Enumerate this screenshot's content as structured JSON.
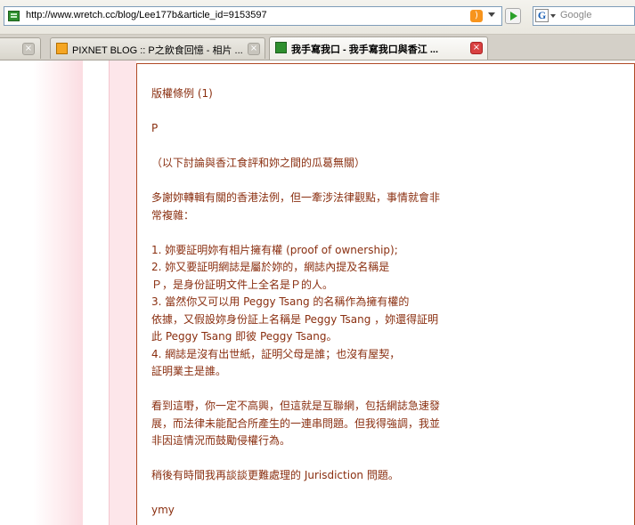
{
  "address_bar": {
    "url": "http://www.wretch.cc/blog/Lee177b&article_id=9153597",
    "search_placeholder": "Google"
  },
  "icons": {
    "rss": "rss-feed-icon",
    "go": "go-arrow-icon",
    "search_engine": "google-icon"
  },
  "tabs": [
    {
      "label": "",
      "active": false
    },
    {
      "label": "PIXNET BLOG :: P之飲食回憶 - 相片 ...",
      "active": false
    },
    {
      "label": "我手寫我口 - 我手寫我口與香江 ...",
      "active": true
    }
  ],
  "colors": {
    "text": "#8a2f10",
    "border": "#b04a26",
    "pink_column": "#fde6ea",
    "close_active": "#d94141"
  },
  "article": {
    "title": "版權條例 (1)",
    "author_initial": "P",
    "disclaimer": "（以下討論與香江食評和妳之間的瓜葛無關）",
    "intro_1": "多謝妳轉輯有關的香港法例，但一牽涉法律觀點，事情就會非",
    "intro_2": "常複雜：",
    "point_1": "1. 妳要証明妳有相片擁有權 (proof of ownership);",
    "point_2a": "2. 妳又要証明網誌是屬於妳的，網誌內提及名稱是",
    "point_2b": "Ｐ，是身份証明文件上全名是Ｐ的人。",
    "point_3a": "3. 當然你又可以用 Peggy Tsang 的名稱作為擁有權的",
    "point_3b": "依據，又假設妳身份証上名稱是 Peggy Tsang ，妳還得証明",
    "point_3c": "此 Peggy Tsang 即彼 Peggy Tsang。",
    "point_4a": "4. 網誌是沒有出世紙，証明父母是誰；也沒有屋契，",
    "point_4b": "証明業主是誰。",
    "closing_1": "看到這嘢，你一定不高興，但這就是互聯網，包括網誌急速發",
    "closing_2": "展，而法律未能配合所產生的一連串問題。但我得強調，我並",
    "closing_3": "非因這情況而鼓勵侵權行為。",
    "followup": "稍後有時間我再談談更難處理的 Jurisdiction 問題。",
    "signature": "ymy"
  }
}
